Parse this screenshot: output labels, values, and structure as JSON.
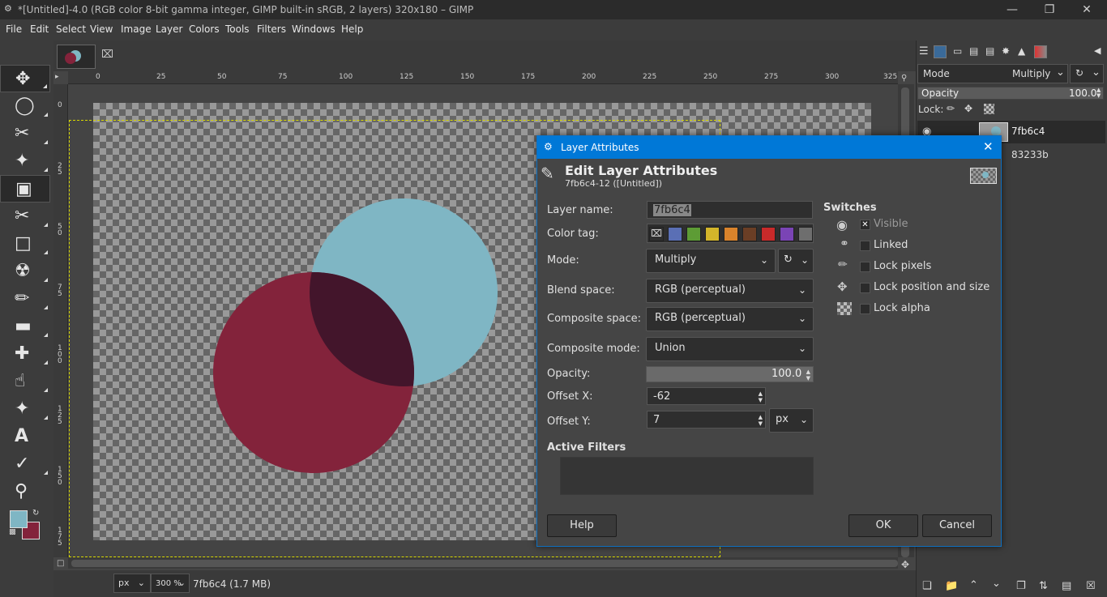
{
  "window": {
    "title": "*[Untitled]-4.0 (RGB color 8-bit gamma integer, GIMP built-in sRGB, 2 layers) 320x180 – GIMP",
    "min_icon": "minimize-icon",
    "max_icon": "maximize-icon",
    "close_icon": "close-icon"
  },
  "menubar": [
    "File",
    "Edit",
    "Select",
    "View",
    "Image",
    "Layer",
    "Colors",
    "Tools",
    "Filters",
    "Windows",
    "Help"
  ],
  "ruler": {
    "h_ticks": [
      "0",
      "25",
      "50",
      "75",
      "100",
      "125",
      "150",
      "175",
      "200",
      "225",
      "250",
      "275",
      "300",
      "325"
    ],
    "v_ticks": [
      "0",
      "2\n5",
      "5\n0",
      "7\n5",
      "1\n0\n0",
      "1\n2\n5",
      "1\n5\n0",
      "1\n7\n5"
    ]
  },
  "colors": {
    "fg": "#7fb6c4",
    "bg": "#83233b",
    "overlap": "#43152b",
    "accent": "#0078d7"
  },
  "statusbar": {
    "unit": "px",
    "zoom": "300 %",
    "info": "7fb6c4 (1.7 MB)"
  },
  "layers_panel": {
    "mode_label": "Mode",
    "mode_value": "Multiply",
    "opacity_label": "Opacity",
    "opacity_value": "100.0",
    "lock_label": "Lock:",
    "layers": [
      {
        "name": "7fb6c4",
        "color": "#7fb6c4"
      },
      {
        "name": "83233b",
        "color": "#83233b"
      }
    ]
  },
  "dialog": {
    "title": "Layer Attributes",
    "heading": "Edit Layer Attributes",
    "subheading": "7fb6c4-12 ([Untitled])",
    "labels": {
      "layer_name": "Layer name:",
      "color_tag": "Color tag:",
      "mode": "Mode:",
      "blend_space": "Blend space:",
      "composite_space": "Composite space:",
      "composite_mode": "Composite mode:",
      "opacity": "Opacity:",
      "offset_x": "Offset X:",
      "offset_y": "Offset Y:",
      "active_filters": "Active Filters",
      "switches": "Switches"
    },
    "values": {
      "layer_name": "7fb6c4",
      "mode": "Multiply",
      "blend_space": "RGB (perceptual)",
      "composite_space": "RGB (perceptual)",
      "composite_mode": "Union",
      "opacity": "100.0",
      "offset_x": "-62",
      "offset_y": "7",
      "unit": "px"
    },
    "color_tags": [
      "#5a6fb5",
      "#5d9c35",
      "#d3b52a",
      "#d9832b",
      "#6a3e25",
      "#c82a2a",
      "#7a44b5",
      "#6e6e6e"
    ],
    "switches": [
      {
        "label": "Visible",
        "checked": true,
        "icon": "eye-icon"
      },
      {
        "label": "Linked",
        "checked": false,
        "icon": "chain-icon"
      },
      {
        "label": "Lock pixels",
        "checked": false,
        "icon": "brush-icon"
      },
      {
        "label": "Lock position and size",
        "checked": false,
        "icon": "move-icon"
      },
      {
        "label": "Lock alpha",
        "checked": false,
        "icon": "checker-icon"
      }
    ],
    "buttons": {
      "help": "Help",
      "ok": "OK",
      "cancel": "Cancel"
    }
  }
}
